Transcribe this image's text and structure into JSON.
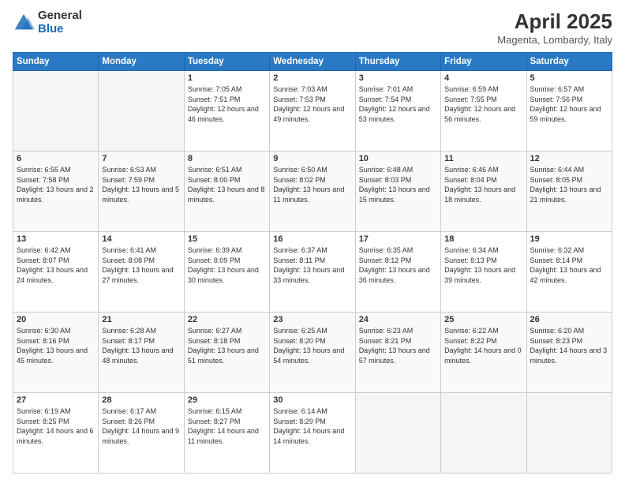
{
  "logo": {
    "general": "General",
    "blue": "Blue"
  },
  "header": {
    "title": "April 2025",
    "subtitle": "Magenta, Lombardy, Italy"
  },
  "weekdays": [
    "Sunday",
    "Monday",
    "Tuesday",
    "Wednesday",
    "Thursday",
    "Friday",
    "Saturday"
  ],
  "weeks": [
    [
      {
        "day": "",
        "sunrise": "",
        "sunset": "",
        "daylight": ""
      },
      {
        "day": "",
        "sunrise": "",
        "sunset": "",
        "daylight": ""
      },
      {
        "day": "1",
        "sunrise": "Sunrise: 7:05 AM",
        "sunset": "Sunset: 7:51 PM",
        "daylight": "Daylight: 12 hours and 46 minutes."
      },
      {
        "day": "2",
        "sunrise": "Sunrise: 7:03 AM",
        "sunset": "Sunset: 7:53 PM",
        "daylight": "Daylight: 12 hours and 49 minutes."
      },
      {
        "day": "3",
        "sunrise": "Sunrise: 7:01 AM",
        "sunset": "Sunset: 7:54 PM",
        "daylight": "Daylight: 12 hours and 53 minutes."
      },
      {
        "day": "4",
        "sunrise": "Sunrise: 6:59 AM",
        "sunset": "Sunset: 7:55 PM",
        "daylight": "Daylight: 12 hours and 56 minutes."
      },
      {
        "day": "5",
        "sunrise": "Sunrise: 6:57 AM",
        "sunset": "Sunset: 7:56 PM",
        "daylight": "Daylight: 12 hours and 59 minutes."
      }
    ],
    [
      {
        "day": "6",
        "sunrise": "Sunrise: 6:55 AM",
        "sunset": "Sunset: 7:58 PM",
        "daylight": "Daylight: 13 hours and 2 minutes."
      },
      {
        "day": "7",
        "sunrise": "Sunrise: 6:53 AM",
        "sunset": "Sunset: 7:59 PM",
        "daylight": "Daylight: 13 hours and 5 minutes."
      },
      {
        "day": "8",
        "sunrise": "Sunrise: 6:51 AM",
        "sunset": "Sunset: 8:00 PM",
        "daylight": "Daylight: 13 hours and 8 minutes."
      },
      {
        "day": "9",
        "sunrise": "Sunrise: 6:50 AM",
        "sunset": "Sunset: 8:02 PM",
        "daylight": "Daylight: 13 hours and 11 minutes."
      },
      {
        "day": "10",
        "sunrise": "Sunrise: 6:48 AM",
        "sunset": "Sunset: 8:03 PM",
        "daylight": "Daylight: 13 hours and 15 minutes."
      },
      {
        "day": "11",
        "sunrise": "Sunrise: 6:46 AM",
        "sunset": "Sunset: 8:04 PM",
        "daylight": "Daylight: 13 hours and 18 minutes."
      },
      {
        "day": "12",
        "sunrise": "Sunrise: 6:44 AM",
        "sunset": "Sunset: 8:05 PM",
        "daylight": "Daylight: 13 hours and 21 minutes."
      }
    ],
    [
      {
        "day": "13",
        "sunrise": "Sunrise: 6:42 AM",
        "sunset": "Sunset: 8:07 PM",
        "daylight": "Daylight: 13 hours and 24 minutes."
      },
      {
        "day": "14",
        "sunrise": "Sunrise: 6:41 AM",
        "sunset": "Sunset: 8:08 PM",
        "daylight": "Daylight: 13 hours and 27 minutes."
      },
      {
        "day": "15",
        "sunrise": "Sunrise: 6:39 AM",
        "sunset": "Sunset: 8:09 PM",
        "daylight": "Daylight: 13 hours and 30 minutes."
      },
      {
        "day": "16",
        "sunrise": "Sunrise: 6:37 AM",
        "sunset": "Sunset: 8:11 PM",
        "daylight": "Daylight: 13 hours and 33 minutes."
      },
      {
        "day": "17",
        "sunrise": "Sunrise: 6:35 AM",
        "sunset": "Sunset: 8:12 PM",
        "daylight": "Daylight: 13 hours and 36 minutes."
      },
      {
        "day": "18",
        "sunrise": "Sunrise: 6:34 AM",
        "sunset": "Sunset: 8:13 PM",
        "daylight": "Daylight: 13 hours and 39 minutes."
      },
      {
        "day": "19",
        "sunrise": "Sunrise: 6:32 AM",
        "sunset": "Sunset: 8:14 PM",
        "daylight": "Daylight: 13 hours and 42 minutes."
      }
    ],
    [
      {
        "day": "20",
        "sunrise": "Sunrise: 6:30 AM",
        "sunset": "Sunset: 8:16 PM",
        "daylight": "Daylight: 13 hours and 45 minutes."
      },
      {
        "day": "21",
        "sunrise": "Sunrise: 6:28 AM",
        "sunset": "Sunset: 8:17 PM",
        "daylight": "Daylight: 13 hours and 48 minutes."
      },
      {
        "day": "22",
        "sunrise": "Sunrise: 6:27 AM",
        "sunset": "Sunset: 8:18 PM",
        "daylight": "Daylight: 13 hours and 51 minutes."
      },
      {
        "day": "23",
        "sunrise": "Sunrise: 6:25 AM",
        "sunset": "Sunset: 8:20 PM",
        "daylight": "Daylight: 13 hours and 54 minutes."
      },
      {
        "day": "24",
        "sunrise": "Sunrise: 6:23 AM",
        "sunset": "Sunset: 8:21 PM",
        "daylight": "Daylight: 13 hours and 57 minutes."
      },
      {
        "day": "25",
        "sunrise": "Sunrise: 6:22 AM",
        "sunset": "Sunset: 8:22 PM",
        "daylight": "Daylight: 14 hours and 0 minutes."
      },
      {
        "day": "26",
        "sunrise": "Sunrise: 6:20 AM",
        "sunset": "Sunset: 8:23 PM",
        "daylight": "Daylight: 14 hours and 3 minutes."
      }
    ],
    [
      {
        "day": "27",
        "sunrise": "Sunrise: 6:19 AM",
        "sunset": "Sunset: 8:25 PM",
        "daylight": "Daylight: 14 hours and 6 minutes."
      },
      {
        "day": "28",
        "sunrise": "Sunrise: 6:17 AM",
        "sunset": "Sunset: 8:26 PM",
        "daylight": "Daylight: 14 hours and 9 minutes."
      },
      {
        "day": "29",
        "sunrise": "Sunrise: 6:15 AM",
        "sunset": "Sunset: 8:27 PM",
        "daylight": "Daylight: 14 hours and 11 minutes."
      },
      {
        "day": "30",
        "sunrise": "Sunrise: 6:14 AM",
        "sunset": "Sunset: 8:29 PM",
        "daylight": "Daylight: 14 hours and 14 minutes."
      },
      {
        "day": "",
        "sunrise": "",
        "sunset": "",
        "daylight": ""
      },
      {
        "day": "",
        "sunrise": "",
        "sunset": "",
        "daylight": ""
      },
      {
        "day": "",
        "sunrise": "",
        "sunset": "",
        "daylight": ""
      }
    ]
  ]
}
